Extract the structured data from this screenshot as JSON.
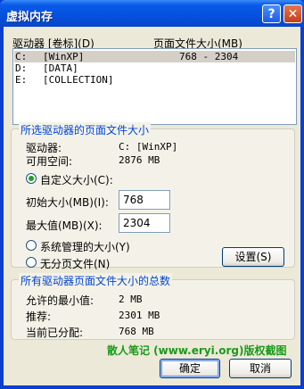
{
  "window": {
    "title": "虚拟内存",
    "help_label": "?",
    "close_label": "✕"
  },
  "header": {
    "drive_col": "驱动器 [卷标](D)",
    "size_col": "页面文件大小(MB)"
  },
  "drives": [
    {
      "letter": "C:",
      "label": "[WinXP]",
      "size": "768 - 2304",
      "selected": true
    },
    {
      "letter": "D:",
      "label": "[DATA]",
      "size": "",
      "selected": false
    },
    {
      "letter": "E:",
      "label": "[COLLECTION]",
      "size": "",
      "selected": false
    }
  ],
  "selected_drive": {
    "group_title": "所选驱动器的页面文件大小",
    "drive_label": "驱动器:",
    "drive_value": "C:  [WinXP]",
    "space_label": "可用空间:",
    "space_value": "2876 MB",
    "custom_label": "自定义大小(C):",
    "initial_label": "初始大小(MB)(I):",
    "initial_value": "768",
    "max_label": "最大值(MB)(X):",
    "max_value": "2304",
    "system_label": "系统管理的大小(Y)",
    "none_label": "无分页文件(N)",
    "set_button": "设置(S)"
  },
  "totals": {
    "group_title": "所有驱动器页面文件大小的总数",
    "min_label": "允许的最小值:",
    "min_value": "2 MB",
    "rec_label": "推荐:",
    "rec_value": "2301 MB",
    "cur_label": "当前已分配:",
    "cur_value": "768 MB"
  },
  "watermark": "散人笔记 (www.eryi.org)版权截图",
  "buttons": {
    "ok": "确定",
    "cancel": "取消"
  }
}
